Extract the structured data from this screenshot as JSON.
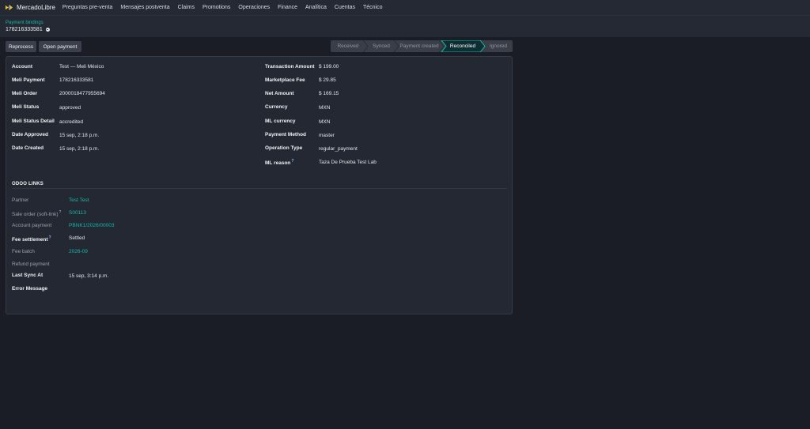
{
  "app": {
    "name": "MercadoLibre"
  },
  "nav": {
    "items": [
      "Preguntas pre-venta",
      "Mensajes postventa",
      "Claims",
      "Promotions",
      "Operaciones",
      "Finance",
      "Analítica",
      "Cuentas",
      "Técnico"
    ]
  },
  "breadcrumb": {
    "parent": "Payment bindings",
    "current": "178216333581"
  },
  "actions": {
    "reprocess": "Reprocess",
    "open_payment": "Open payment"
  },
  "status": {
    "stages": [
      "Received",
      "Synced",
      "Payment created",
      "Reconciled",
      "Ignored"
    ],
    "active": "Reconciled",
    "accent": "#14b8a6"
  },
  "details": {
    "left": [
      {
        "label": "Account",
        "value": "Test — Meli México"
      },
      {
        "label": "Meli Payment",
        "value": "178216333581"
      },
      {
        "label": "Meli Order",
        "value": "2000018477955694"
      },
      {
        "label": "Meli Status",
        "value": "approved"
      },
      {
        "label": "Meli Status Detail",
        "value": "accredited"
      },
      {
        "label": "Date Approved",
        "value": "15 sep, 2:18 p.m."
      },
      {
        "label": "Date Created",
        "value": "15 sep, 2:18 p.m."
      }
    ],
    "right": [
      {
        "label": "Transaction Amount",
        "value": "$ 199.00"
      },
      {
        "label": "Marketplace Fee",
        "value": "$ 29.85"
      },
      {
        "label": "Net Amount",
        "value": "$ 169.15"
      },
      {
        "label": "Currency",
        "value": "MXN"
      },
      {
        "label": "ML currency",
        "value": "MXN"
      },
      {
        "label": "Payment Method",
        "value": "master"
      },
      {
        "label": "Operation Type",
        "value": "regular_payment"
      },
      {
        "label": "ML reason",
        "value": "Taza De Prueba Test Lab",
        "tooltip": "?"
      }
    ]
  },
  "odoo": {
    "title": "ODOO LINKS",
    "rows": [
      {
        "label": "Partner",
        "value": "Test Test",
        "link": true
      },
      {
        "label": "Sale order (soft-link)",
        "value": "S00113",
        "link": true,
        "tooltip": "?"
      },
      {
        "label": "Account payment",
        "value": "PBNK1/2026/00003",
        "link": true
      },
      {
        "label": "Fee settlement",
        "value": "Settled",
        "link": false,
        "tooltip": "?"
      },
      {
        "label": "Fee batch",
        "value": "2026-09",
        "link": true
      },
      {
        "label": "Refund payment",
        "value": ""
      },
      {
        "label": "Last Sync At",
        "value": "15 sep, 3:14 p.m."
      },
      {
        "label": "Error Message",
        "value": ""
      }
    ]
  }
}
